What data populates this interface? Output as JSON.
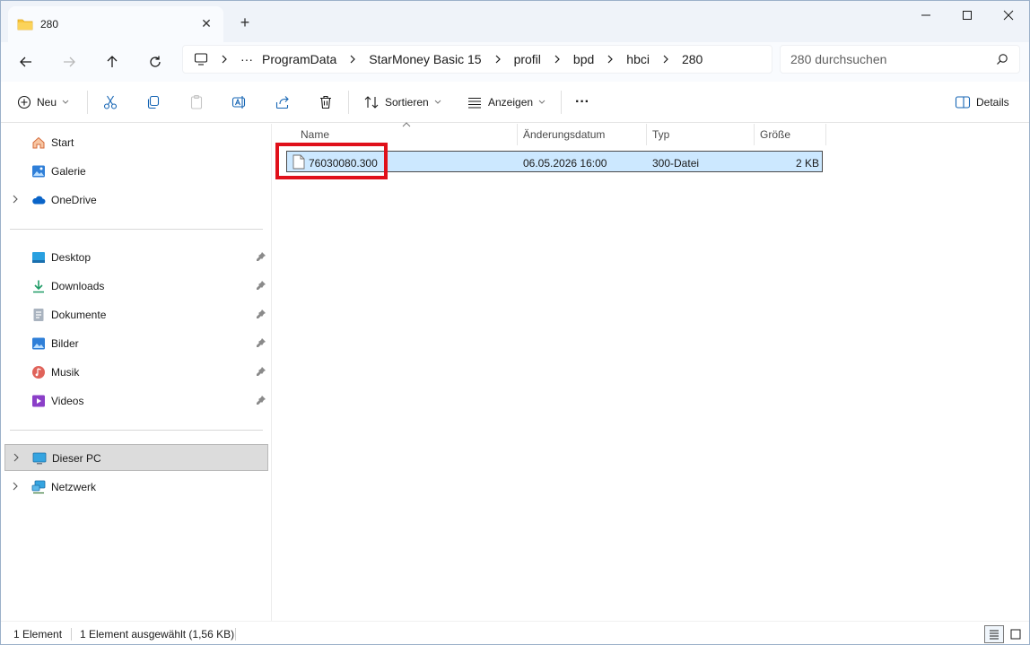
{
  "tab": {
    "title": "280",
    "close": "✕",
    "new_tab": "+"
  },
  "address": {
    "ellipsis": "···",
    "crumbs": [
      "ProgramData",
      "StarMoney Basic 15",
      "profil",
      "bpd",
      "hbci",
      "280"
    ]
  },
  "search": {
    "placeholder": "280 durchsuchen"
  },
  "toolbar": {
    "new_label": "Neu",
    "sort_label": "Sortieren",
    "view_label": "Anzeigen",
    "more_label": "···",
    "details_label": "Details"
  },
  "sidebar": {
    "top": [
      {
        "label": "Start",
        "icon": "home-icon"
      },
      {
        "label": "Galerie",
        "icon": "gallery-icon"
      },
      {
        "label": "OneDrive",
        "icon": "cloud-icon"
      }
    ],
    "quick": [
      {
        "label": "Desktop",
        "icon": "desktop-icon"
      },
      {
        "label": "Downloads",
        "icon": "download-icon"
      },
      {
        "label": "Dokumente",
        "icon": "document-icon"
      },
      {
        "label": "Bilder",
        "icon": "pictures-icon"
      },
      {
        "label": "Musik",
        "icon": "music-icon"
      },
      {
        "label": "Videos",
        "icon": "video-icon"
      }
    ],
    "bottom": [
      {
        "label": "Dieser PC",
        "icon": "pc-icon"
      },
      {
        "label": "Netzwerk",
        "icon": "network-icon"
      }
    ]
  },
  "columns": {
    "name": "Name",
    "date": "Änderungsdatum",
    "type": "Typ",
    "size": "Größe"
  },
  "files": [
    {
      "name": "76030080.300",
      "date": "06.05.2026 16:00",
      "type": "300-Datei",
      "size": "2 KB"
    }
  ],
  "status": {
    "count": "1 Element",
    "selection": "1 Element ausgewählt (1,56 KB)"
  },
  "colors": {
    "accent": "#0067c0",
    "selection": "#cce8ff",
    "highlight": "#e0101a",
    "folder": "#f8c43a"
  }
}
